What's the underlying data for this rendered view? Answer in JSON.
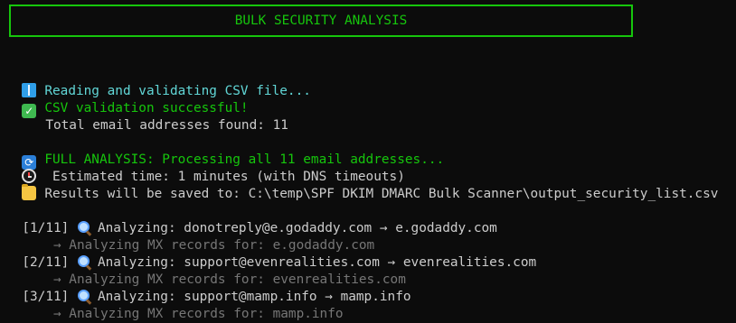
{
  "banner": {
    "title": "BULK SECURITY ANALYSIS"
  },
  "lines": {
    "reading": "Reading and validating CSV file...",
    "validated": "CSV validation successful!",
    "total": "   Total email addresses found: 11",
    "full_analysis": "FULL ANALYSIS: Processing all 11 email addresses...",
    "estimated": " Estimated time: 1 minutes (with DNS timeouts)",
    "results": "Results will be saved to: C:\\temp\\SPF DKIM DMARC Bulk Scanner\\output_security_list.csv"
  },
  "entries": [
    {
      "index": "[1/11] ",
      "analyzing": "Analyzing: donotreply@e.godaddy.com → e.godaddy.com",
      "mx": "    → Analyzing MX records for: e.godaddy.com"
    },
    {
      "index": "[2/11] ",
      "analyzing": "Analyzing: support@evenrealities.com → evenrealities.com",
      "mx": "    → Analyzing MX records for: evenrealities.com"
    },
    {
      "index": "[3/11] ",
      "analyzing": "Analyzing: support@mamp.info → mamp.info",
      "mx": "    → Analyzing MX records for: mamp.info"
    }
  ],
  "icons": {
    "reading": "open-book-icon",
    "validated": "check-mark-icon",
    "full_analysis": "refresh-arrows-icon",
    "estimated": "alarm-clock-icon",
    "results": "folder-icon",
    "analyzing": "magnifying-glass-icon"
  },
  "colors": {
    "background": "#0c0c0c",
    "green": "#16c60c",
    "cyan": "#61d6d6",
    "text": "#cccccc",
    "dim": "#767676"
  }
}
